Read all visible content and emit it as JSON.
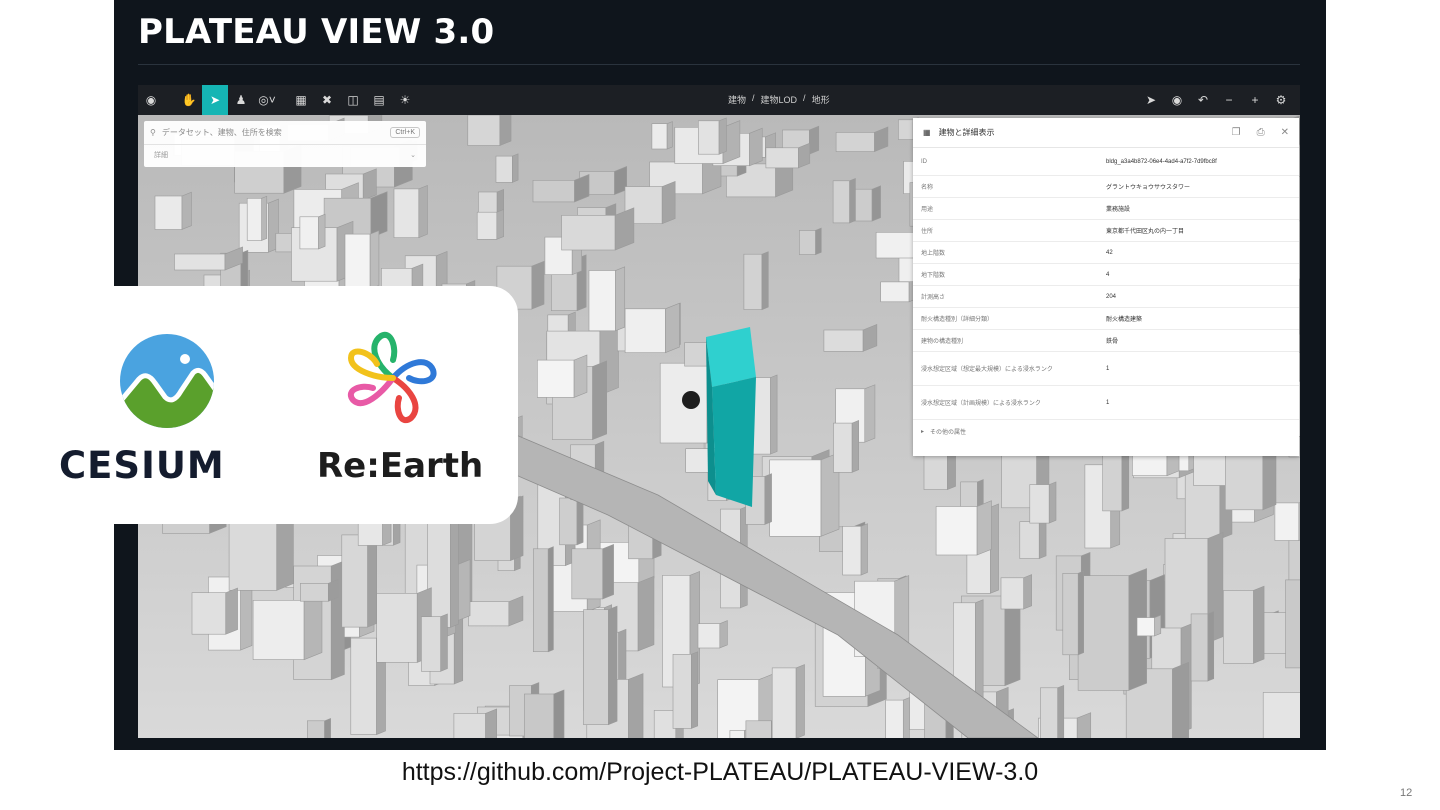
{
  "title": "PLATEAU VIEW 3.0",
  "toolbar": {
    "left_icons": [
      "logo-icon",
      "hand-icon",
      "cursor-icon",
      "pedestrian-icon",
      "location-icon",
      "grid-icon",
      "measure-icon",
      "compare-icon",
      "panel-icon",
      "sun-icon"
    ],
    "breadcrumb": [
      "建物",
      "建物LOD",
      "地形"
    ],
    "right_icons": [
      "send-icon",
      "camera-icon",
      "undo-icon",
      "minus-icon",
      "plus-icon",
      "settings-icon"
    ]
  },
  "search": {
    "placeholder": "データセット、建物、住所を検索",
    "shortcut": "Ctrl+K",
    "filter_label": "詳細"
  },
  "info_panel": {
    "title": "建物と詳細表示",
    "rows": [
      {
        "key": "ID",
        "value": "bldg_a3a4b872-06e4-4ad4-a7f2-7d9fbc8f"
      },
      {
        "key": "名称",
        "value": "グラントウキョウサウスタワー"
      },
      {
        "key": "用途",
        "value": "業務施設"
      },
      {
        "key": "住所",
        "value": "東京都千代田区丸の内一丁目"
      },
      {
        "key": "地上階数",
        "value": "42"
      },
      {
        "key": "地下階数",
        "value": "4"
      },
      {
        "key": "計測高さ",
        "value": "204"
      },
      {
        "key": "耐火構造種別（詳細分類）",
        "value": "耐火構造建築"
      },
      {
        "key": "建物の構造種別",
        "value": "鉄骨"
      },
      {
        "key": "浸水想定区域（想定最大規模）による浸水ランク",
        "value": "1"
      },
      {
        "key": "浸水想定区域（計画規模）による浸水ランク",
        "value": "1"
      }
    ],
    "footer": "その他の属性"
  },
  "logos": {
    "cesium": "CESIUM",
    "reearth": "Re:Earth"
  },
  "footer_url": "https://github.com/Project-PLATEAU/PLATEAU-VIEW-3.0",
  "page_number": "12",
  "colors": {
    "accent": "#15b5b4",
    "selected_building": "#11a6a5",
    "frame": "#0f151c",
    "cesium_sky": "#4aa3e0",
    "cesium_grass": "#5aa02c"
  }
}
